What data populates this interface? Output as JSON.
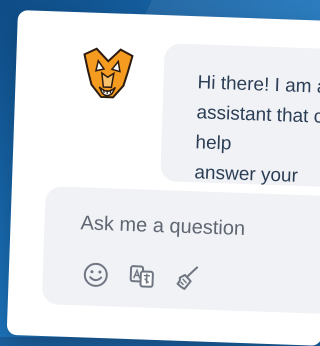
{
  "chat": {
    "assistant_message": "Hi there! I am an\nassistant that can help\nanswer your questions",
    "input_placeholder": "Ask me a question"
  },
  "toolbar": {
    "icons": [
      "emoji-icon",
      "translate-icon",
      "broom-icon"
    ]
  },
  "colors": {
    "background": "#1a5f9e",
    "card": "#ffffff",
    "bubble": "#f0f2f6",
    "text": "#2c3e55",
    "icon": "#6f7682",
    "mascot_orange": "#f59b1f"
  }
}
